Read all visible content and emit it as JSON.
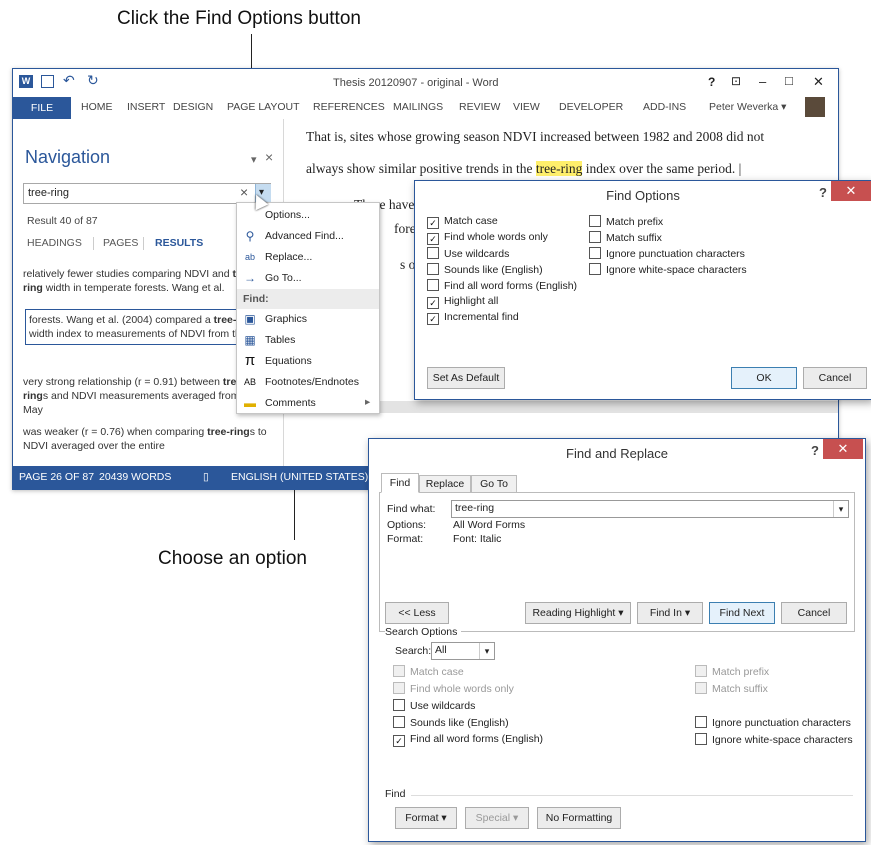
{
  "callouts": {
    "top": "Click the Find Options button",
    "bottom": "Choose an option"
  },
  "word": {
    "title": "Thesis 20120907 - original - Word",
    "qat": {
      "undo": "↶",
      "redo": "↻"
    },
    "window_controls": {
      "help": "?",
      "restore_ribbon": "⊡",
      "minimize": "–",
      "maximize": "□",
      "close": "✕"
    },
    "ribbon_tabs": [
      "FILE",
      "HOME",
      "INSERT",
      "DESIGN",
      "PAGE LAYOUT",
      "REFERENCES",
      "MAILINGS",
      "REVIEW",
      "VIEW",
      "DEVELOPER",
      "ADD-INS"
    ],
    "user": "Peter Weverka ▾",
    "status": {
      "page": "PAGE 26 OF 87",
      "words": "20439 WORDS",
      "language": "ENGLISH (UNITED STATES)"
    },
    "accent": "#2b579a"
  },
  "navigation": {
    "title": "Navigation",
    "pin": "▾",
    "close": "×",
    "search_value": "tree-ring",
    "clear": "×",
    "dropdown": "▾",
    "result_count": "Result 40 of 87",
    "tabs": [
      "HEADINGS",
      "PAGES",
      "RESULTS"
    ],
    "results": [
      {
        "pre": "relatively fewer studies comparing NDVI and ",
        "b": "tree-ring",
        "post": " width in temperate forests. Wang et al."
      },
      {
        "pre": "forests. Wang et al. (2004) compared a ",
        "b": "tree-ring",
        "post": " width index to measurements of NDVI from the"
      },
      {
        "pre": "very strong relationship (r = 0.91) between ",
        "b": "tree-ring",
        "post": "s and NDVI measurements averaged from mid-May"
      },
      {
        "pre": "was weaker (r = 0.76) when comparing ",
        "b": "tree-ring",
        "post": "s to NDVI averaged over the entire"
      }
    ]
  },
  "document": {
    "line1": "That is, sites whose growing season NDVI increased between 1982 and 2008 did not",
    "line2_pre": "always show similar positive trends in the ",
    "line2_hl": "tree-ring",
    "line2_post": " index over the same period.",
    "line3": "There have",
    "line4": "forests",
    "line5": "s of N"
  },
  "menu": {
    "items": [
      {
        "icon": "",
        "label": "Options..."
      },
      {
        "icon": "⚲",
        "label": "Advanced Find..."
      },
      {
        "icon": "ab",
        "label": "Replace..."
      },
      {
        "icon": "→",
        "label": "Go To..."
      }
    ],
    "find_header": "Find:",
    "find_items": [
      {
        "icon": "▣",
        "label": "Graphics"
      },
      {
        "icon": "▦",
        "label": "Tables"
      },
      {
        "icon": "π",
        "label": "Equations"
      },
      {
        "icon": "AB",
        "label": "Footnotes/Endnotes"
      },
      {
        "icon": "▬",
        "label": "Comments",
        "arrow": "▸"
      }
    ]
  },
  "find_options": {
    "title": "Find Options",
    "help": "?",
    "close": "✕",
    "left": [
      {
        "label": "Match case",
        "checked": true
      },
      {
        "label": "Find whole words only",
        "checked": true
      },
      {
        "label": "Use wildcards",
        "checked": false
      },
      {
        "label": "Sounds like (English)",
        "checked": false
      },
      {
        "label": "Find all word forms (English)",
        "checked": false
      },
      {
        "label": "Highlight all",
        "checked": true
      },
      {
        "label": "Incremental find",
        "checked": true
      }
    ],
    "right": [
      {
        "label": "Match prefix",
        "checked": false
      },
      {
        "label": "Match suffix",
        "checked": false
      },
      {
        "label": "Ignore punctuation characters",
        "checked": false
      },
      {
        "label": "Ignore white-space characters",
        "checked": false
      }
    ],
    "set_default": "Set As Default",
    "ok": "OK",
    "cancel": "Cancel"
  },
  "find_replace": {
    "title": "Find and Replace",
    "help": "?",
    "close": "✕",
    "tabs": [
      "Find",
      "Replace",
      "Go To"
    ],
    "find_what_label": "Find what:",
    "find_what_value": "tree-ring",
    "options_label": "Options:",
    "options_value": "All Word Forms",
    "format_label": "Format:",
    "format_value": "Font: Italic",
    "less": "<< Less",
    "reading_highlight": "Reading Highlight ▾",
    "find_in": "Find In ▾",
    "find_next": "Find Next",
    "cancel": "Cancel",
    "search_options_label": "Search Options",
    "search_label": "Search:",
    "search_value": "All",
    "left": [
      {
        "label": "Match case",
        "checked": false,
        "disabled": true
      },
      {
        "label": "Find whole words only",
        "checked": false,
        "disabled": true
      },
      {
        "label": "Use wildcards",
        "checked": false,
        "disabled": false
      },
      {
        "label": "Sounds like (English)",
        "checked": false,
        "disabled": false
      },
      {
        "label": "Find all word forms (English)",
        "checked": true,
        "disabled": false
      }
    ],
    "right": [
      {
        "label": "Match prefix",
        "checked": false,
        "disabled": true
      },
      {
        "label": "Match suffix",
        "checked": false,
        "disabled": true
      },
      {
        "label": "Ignore punctuation characters",
        "checked": false,
        "disabled": false
      },
      {
        "label": "Ignore white-space characters",
        "checked": false,
        "disabled": false
      }
    ],
    "find_section": "Find",
    "format_btn": "Format ▾",
    "special_btn": "Special ▾",
    "no_formatting": "No Formatting"
  }
}
